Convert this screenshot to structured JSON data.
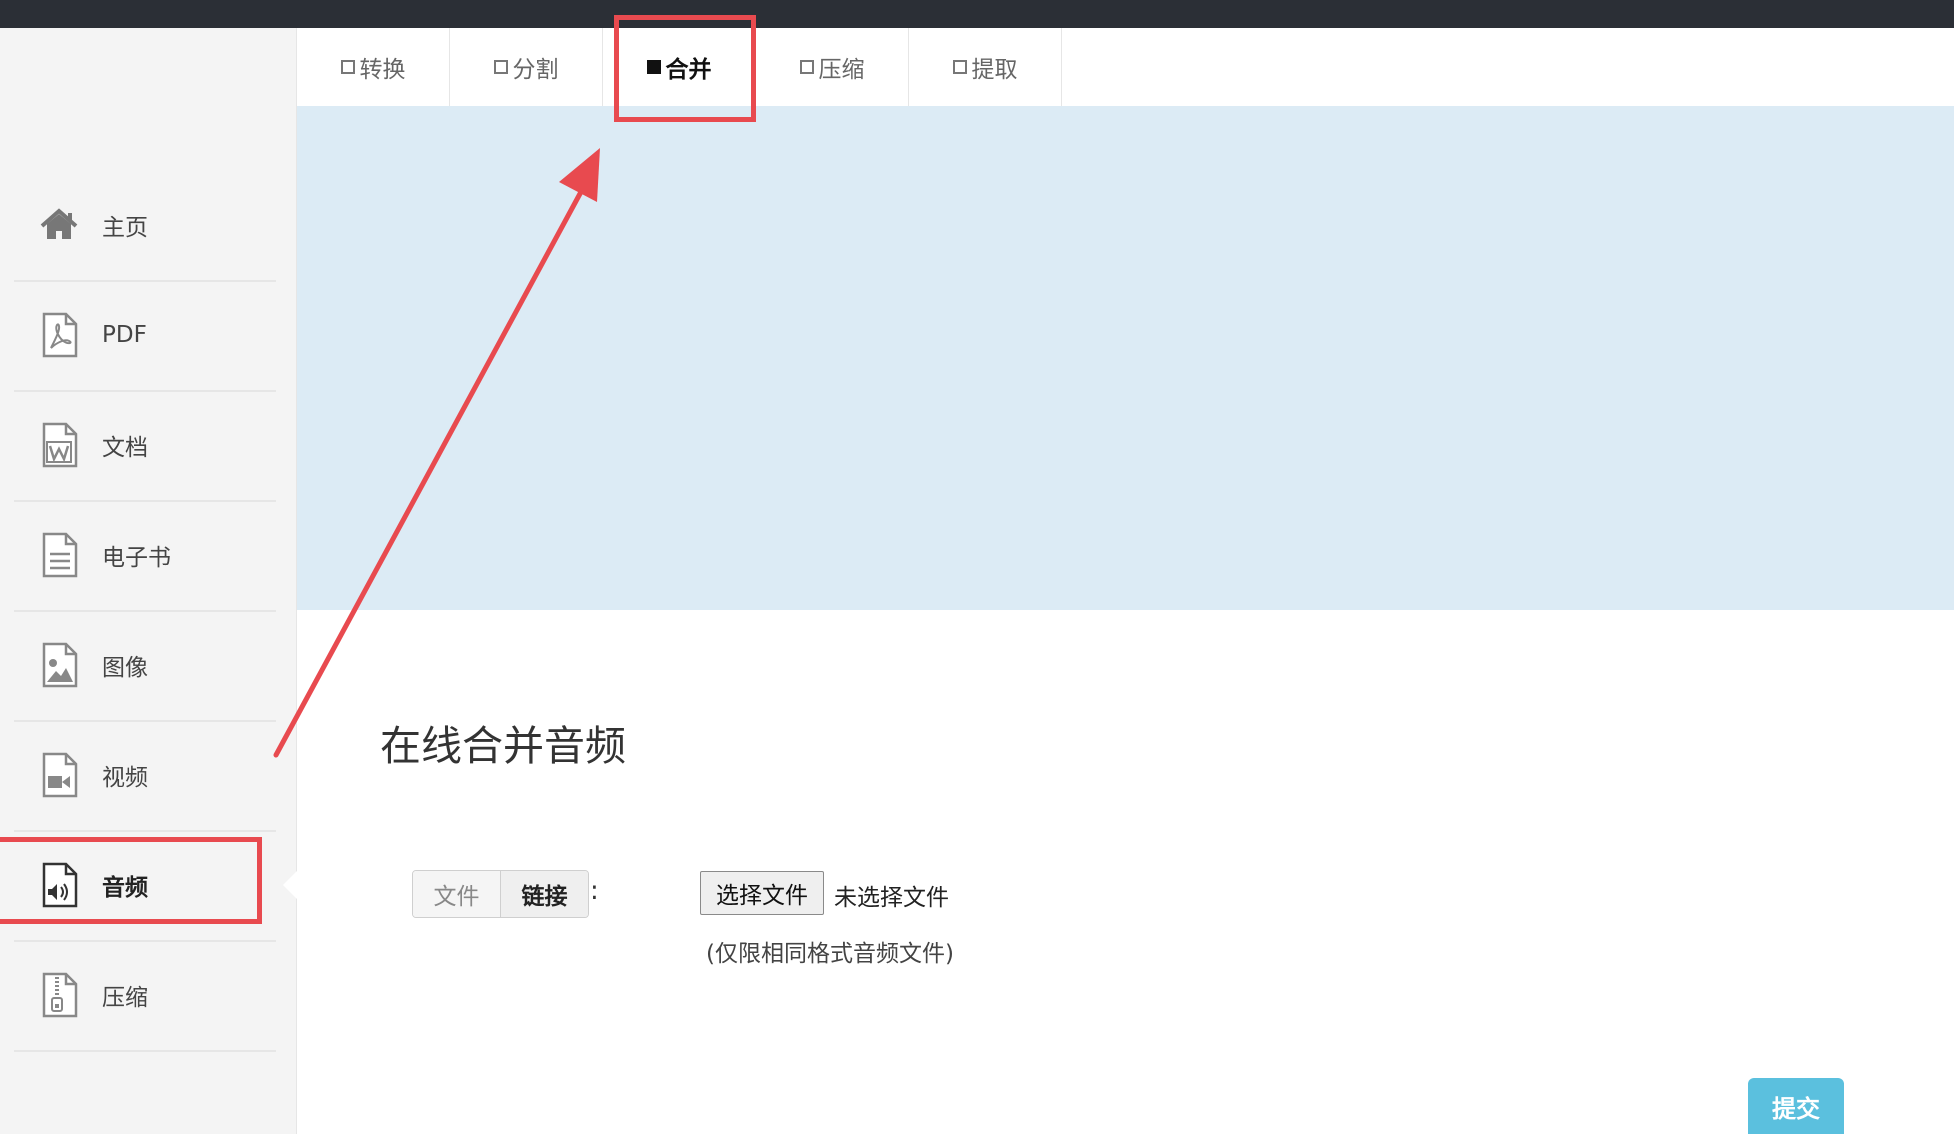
{
  "tabs": [
    {
      "label": "转换",
      "active": false
    },
    {
      "label": "分割",
      "active": false
    },
    {
      "label": "合并",
      "active": true
    },
    {
      "label": "压缩",
      "active": false
    },
    {
      "label": "提取",
      "active": false
    }
  ],
  "sidebar": {
    "items": [
      {
        "label": "主页",
        "icon": "home-icon"
      },
      {
        "label": "PDF",
        "icon": "pdf-file-icon"
      },
      {
        "label": "文档",
        "icon": "word-file-icon"
      },
      {
        "label": "电子书",
        "icon": "ebook-file-icon"
      },
      {
        "label": "图像",
        "icon": "image-file-icon"
      },
      {
        "label": "视频",
        "icon": "video-file-icon"
      },
      {
        "label": "音频",
        "icon": "audio-file-icon",
        "active": true
      },
      {
        "label": "压缩",
        "icon": "archive-file-icon"
      }
    ]
  },
  "main": {
    "title": "在线合并音频",
    "source_toggle": {
      "file_label": "文件",
      "link_label": "链接",
      "separator": ":"
    },
    "file_input": {
      "button_label": "选择文件",
      "status": "未选择文件"
    },
    "hint": "(仅限相同格式音频文件)",
    "submit_label": "提交"
  },
  "colors": {
    "accent": "#5bc0de",
    "banner": "#dcebf5",
    "annotation": "#e84a4f",
    "topbar": "#2b2f36"
  }
}
